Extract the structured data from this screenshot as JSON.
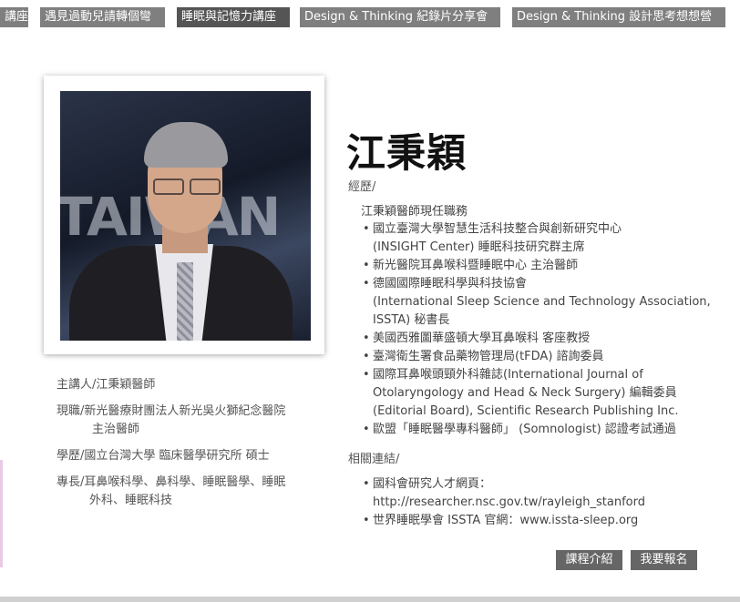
{
  "nav": {
    "tabs": [
      {
        "label": "講座"
      },
      {
        "label": "遇見過動兒請轉個彎"
      },
      {
        "label": "睡眠與記憶力講座"
      },
      {
        "label": "Design & Thinking 紀錄片分享會"
      },
      {
        "label": "Design & Thinking 設計思考想想營"
      }
    ]
  },
  "photo": {
    "background_text": "TAIWAN"
  },
  "bio": {
    "speaker": {
      "label": "主講人/",
      "value": "江秉穎醫師"
    },
    "current": {
      "label": "現職/",
      "line1": "新光醫療財團法人新光吳火獅紀念醫院",
      "line2": "主治醫師"
    },
    "education": {
      "label": "學歷/",
      "value": "國立台灣大學 臨床醫學研究所 碩士"
    },
    "specialty": {
      "label": "專長/",
      "line1": "耳鼻喉科學、鼻科學、睡眠醫學、睡眠",
      "line2": "外科、睡眠科技"
    }
  },
  "profile": {
    "name": "江秉穎",
    "career_label": "經歷/",
    "career_heading": "江秉穎醫師現任職務",
    "career_items": [
      {
        "lines": [
          "國立臺灣大學智慧生活科技整合與創新研究中心",
          "(INSIGHT Center) 睡眠科技研究群主席"
        ]
      },
      {
        "lines": [
          "新光醫院耳鼻喉科暨睡眠中心 主治醫師"
        ]
      },
      {
        "lines": [
          "德國國際睡眠科學與科技協會",
          "(International Sleep Science and Technology Association,",
          "ISSTA) 秘書長"
        ]
      },
      {
        "lines": [
          "美國西雅圖華盛頓大學耳鼻喉科 客座教授"
        ]
      },
      {
        "lines": [
          "臺灣衛生署食品藥物管理局(tFDA) 諮詢委員"
        ]
      },
      {
        "lines": [
          "國際耳鼻喉頭頸外科雜誌(International Journal of",
          "Otolaryngology and Head & Neck Surgery) 編輯委員",
          "(Editorial Board), Scientific Research Publishing Inc."
        ]
      },
      {
        "lines": [
          "歐盟「睡眠醫學專科醫師」 (Somnologist) 認證考試通過"
        ]
      }
    ],
    "links_label": "相關連結/",
    "links": [
      {
        "lines": [
          "國科會研究人才網頁：",
          "http://researcher.nsc.gov.tw/rayleigh_stanford"
        ]
      },
      {
        "lines": [
          "世界睡眠學會 ISSTA 官網：www.issta-sleep.org"
        ]
      }
    ]
  },
  "buttons": {
    "course_intro": "課程介紹",
    "register": "我要報名"
  },
  "colors": {
    "tab_bg": "#7f7f7f",
    "tab_active_bg": "#555555",
    "button_bg": "#666666",
    "name_color": "#111111"
  }
}
